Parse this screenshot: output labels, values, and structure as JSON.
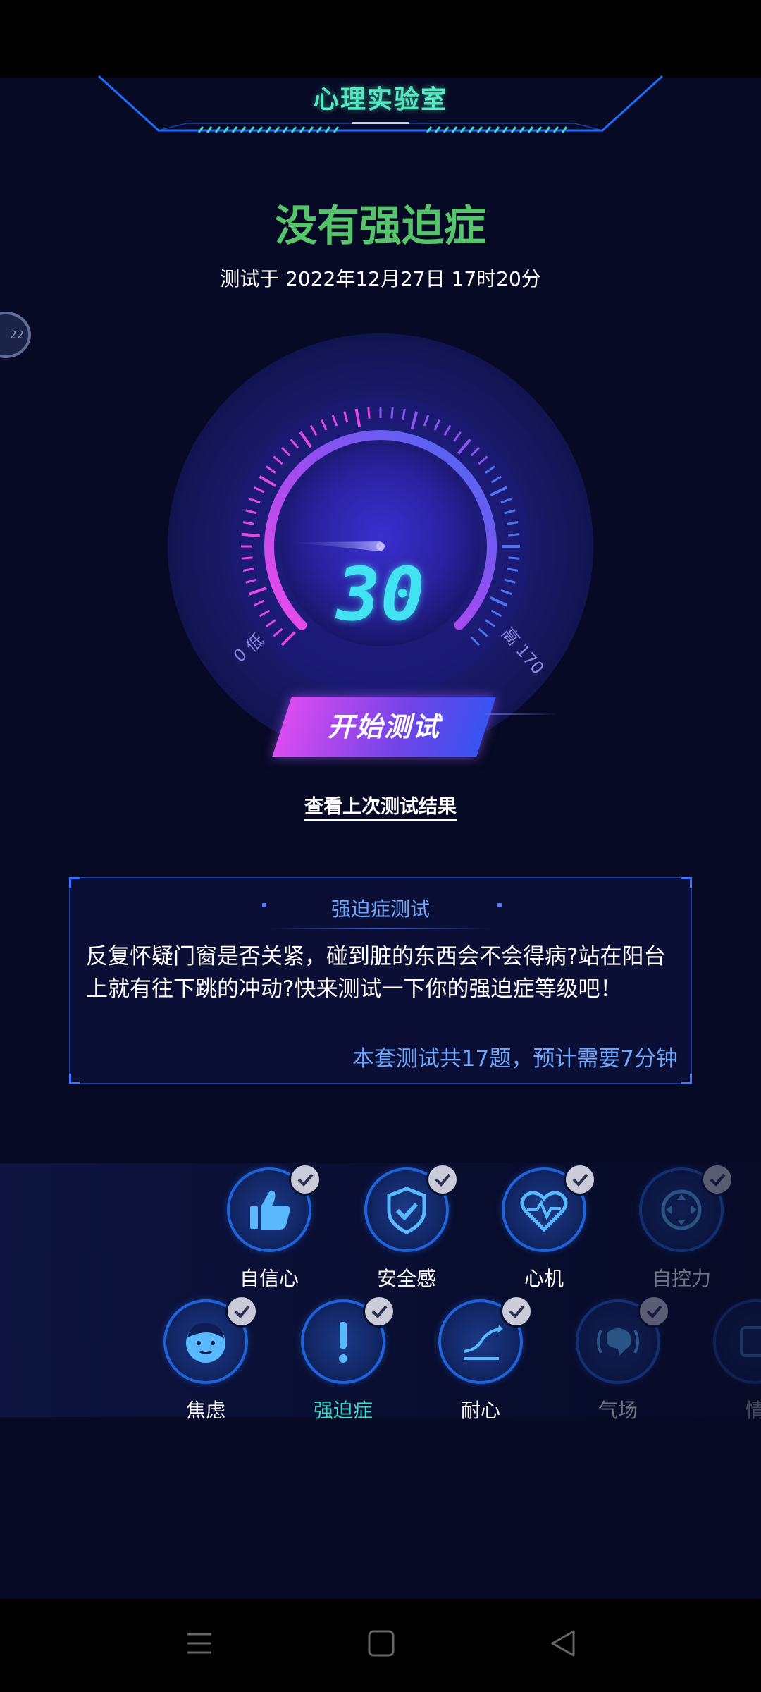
{
  "header": {
    "title": "心理实验室"
  },
  "result": {
    "title": "没有强迫症",
    "tested_at": "测试于 2022年12月27日 17时20分",
    "side_bubble": "22"
  },
  "gauge": {
    "value": "30",
    "level": 30,
    "min_label": "0 低",
    "max_label": "高 170",
    "accent_colors": [
      "#e84ce6",
      "#7c4df0",
      "#3f6cf2",
      "#41e3f2"
    ]
  },
  "actions": {
    "start_label": "开始测试",
    "last_result_label": "查看上次测试结果"
  },
  "info": {
    "title": "强迫症测试",
    "description": "反复怀疑门窗是否关紧，碰到脏的东西会不会得病?站在阳台上就有往下跳的冲动?快来测试一下你的强迫症等级吧！",
    "footer": "本套测试共17题，预计需要7分钟"
  },
  "categories": {
    "row1": [
      {
        "label": "自信心",
        "icon": "thumbs-up-icon",
        "checked": true
      },
      {
        "label": "安全感",
        "icon": "shield-check-icon",
        "checked": true
      },
      {
        "label": "心机",
        "icon": "heart-pulse-icon",
        "checked": true
      },
      {
        "label": "自控力",
        "icon": "joystick-icon",
        "checked": true
      }
    ],
    "row2": [
      {
        "label": "焦虑",
        "icon": "face-icon",
        "checked": true
      },
      {
        "label": "强迫症",
        "icon": "exclamation-icon",
        "checked": true,
        "selected": true,
        "selected_color": "#3fd8c2"
      },
      {
        "label": "耐心",
        "icon": "trend-arrow-icon",
        "checked": true
      },
      {
        "label": "气场",
        "icon": "aura-icon",
        "checked": true
      },
      {
        "label": "情",
        "icon": "emotion-icon",
        "checked": false
      }
    ]
  },
  "navbar": {
    "items": [
      "menu-icon",
      "home-icon",
      "back-icon"
    ]
  }
}
